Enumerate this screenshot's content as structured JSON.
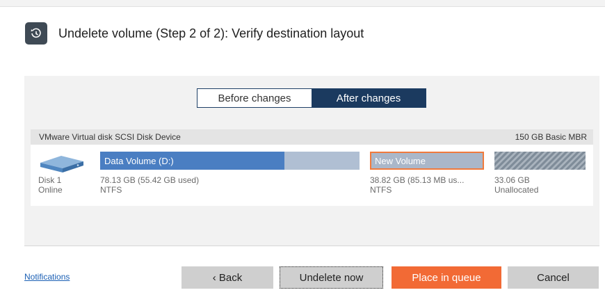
{
  "window": {
    "title": "Undelete volume (Step 2 of 2): Verify destination layout",
    "header_icon": "undelete-history-icon"
  },
  "view_toggle": {
    "before_label": "Before changes",
    "after_label": "After changes",
    "selected": "After changes"
  },
  "disk": {
    "device_name": "VMware Virtual disk SCSI Disk Device",
    "summary": "150 GB Basic MBR",
    "label": "Disk 1",
    "status": "Online",
    "icon": "hard-disk-icon"
  },
  "volumes": [
    {
      "name": "Data Volume (D:)",
      "size": "78.13 GB (55.42 GB used)",
      "fs": "NTFS",
      "used_fraction": 0.71
    },
    {
      "name": "New Volume",
      "size": "38.82 GB (85.13 MB us...",
      "fs": "NTFS",
      "highlighted": true
    },
    {
      "name": "",
      "size": "33.06 GB",
      "fs": "Unallocated"
    }
  ],
  "footer": {
    "notifications_label": "Notifications",
    "back_label": "‹ Back",
    "undelete_label": "Undelete now",
    "queue_label": "Place in queue",
    "cancel_label": "Cancel"
  },
  "colors": {
    "accent": "#f26a35",
    "selected_tab": "#1b3a5f",
    "volume_primary": "#4a7ec2",
    "highlight_border": "#f07a3c"
  }
}
